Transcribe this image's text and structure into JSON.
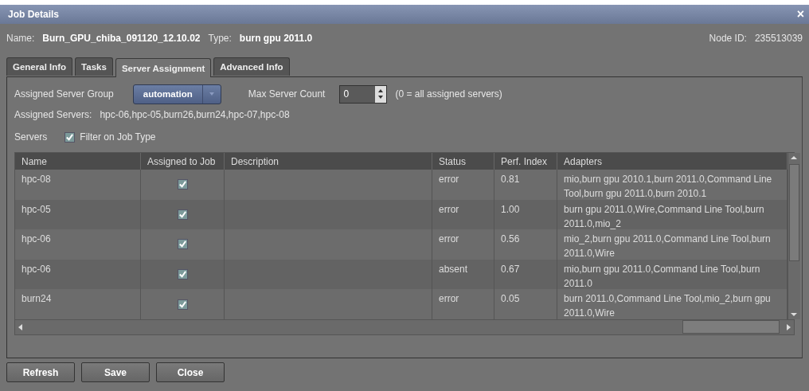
{
  "window": {
    "title": "Job Details",
    "close": "×"
  },
  "job": {
    "name_label": "Name:",
    "name": "Burn_GPU_chiba_091120_12.10.02",
    "type_label": "Type:",
    "type": "burn gpu 2011.0",
    "node_label": "Node ID:",
    "node_id": "235513039"
  },
  "tabs": [
    {
      "label": "General Info",
      "selected": false
    },
    {
      "label": "Tasks",
      "selected": false
    },
    {
      "label": "Server Assignment",
      "selected": true
    },
    {
      "label": "Advanced Info",
      "selected": false
    }
  ],
  "server_group": {
    "label": "Assigned Server Group",
    "value": "automation"
  },
  "max_count": {
    "label": "Max Server Count",
    "value": "0",
    "hint": "(0 = all assigned servers)"
  },
  "assigned_servers": {
    "label": "Assigned Servers:",
    "value": "hpc-06,hpc-05,burn26,burn24,hpc-07,hpc-08"
  },
  "servers": {
    "label": "Servers",
    "filter_label": "Filter on Job Type",
    "filter_checked": true
  },
  "table": {
    "columns": [
      "Name",
      "Assigned to Job",
      "Description",
      "Status",
      "Perf. Index",
      "Adapters"
    ],
    "rows": [
      {
        "name": "hpc-08",
        "assigned": true,
        "status": "error",
        "perf": "0.81",
        "adapters": "mio,burn gpu 2010.1,burn 2011.0,Command Line Tool,burn gpu 2011.0,burn 2010.1"
      },
      {
        "name": "hpc-05",
        "assigned": true,
        "status": "error",
        "perf": "1.00",
        "adapters": "burn gpu 2011.0,Wire,Command Line Tool,burn 2011.0,mio_2"
      },
      {
        "name": "hpc-06",
        "assigned": true,
        "status": "error",
        "perf": "0.56",
        "adapters": "mio_2,burn gpu 2011.0,Command Line Tool,burn 2011.0,Wire"
      },
      {
        "name": "hpc-06",
        "assigned": true,
        "status": "absent",
        "perf": "0.67",
        "adapters": "mio,burn gpu 2011.0,Command Line Tool,burn 2011.0"
      },
      {
        "name": "burn24",
        "assigned": true,
        "status": "error",
        "perf": "0.05",
        "adapters": "burn 2011.0,Command Line Tool,mio_2,burn gpu 2011.0,Wire"
      }
    ]
  },
  "buttons": [
    "Refresh",
    "Save",
    "Close"
  ]
}
